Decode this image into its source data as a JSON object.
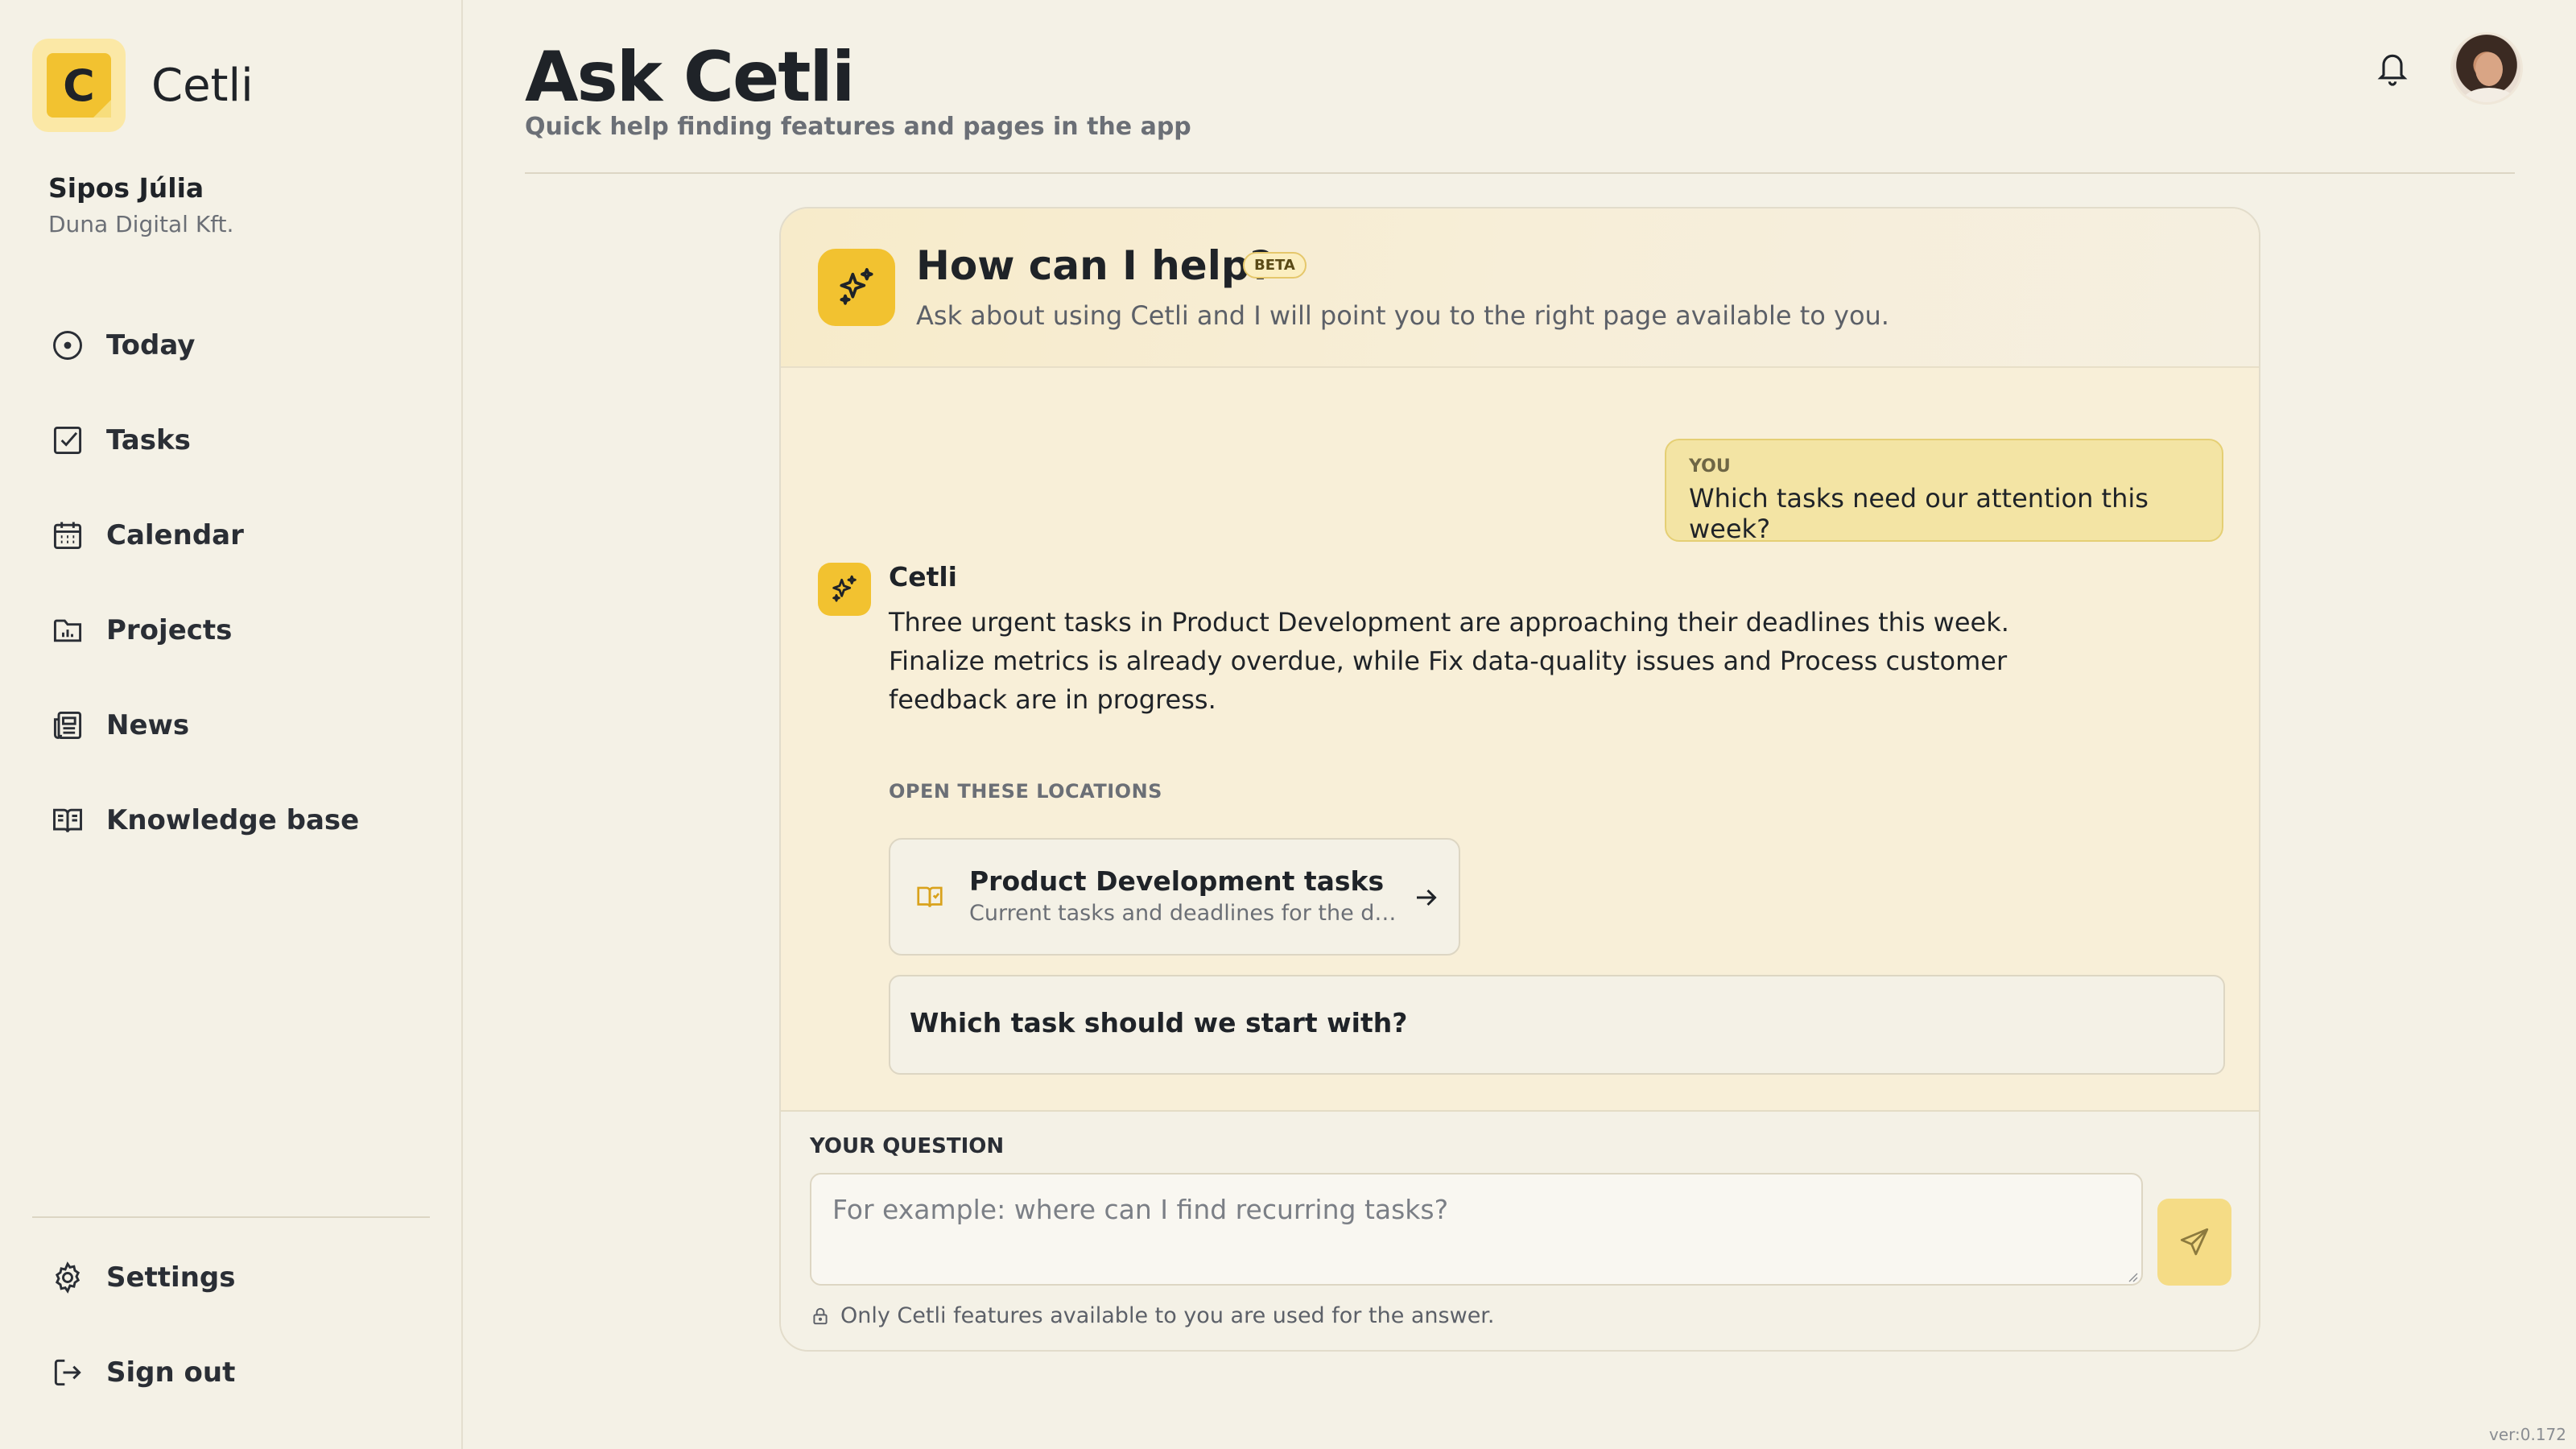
{
  "app": {
    "name": "Cetli",
    "logo_letter": "C"
  },
  "user": {
    "name": "Sipos Júlia",
    "org": "Duna Digital Kft."
  },
  "sidebar": {
    "items": [
      {
        "label": "Today",
        "icon": "clock-circle-icon"
      },
      {
        "label": "Tasks",
        "icon": "checkbox-icon"
      },
      {
        "label": "Calendar",
        "icon": "calendar-icon"
      },
      {
        "label": "Projects",
        "icon": "folder-chart-icon"
      },
      {
        "label": "News",
        "icon": "newspaper-icon"
      },
      {
        "label": "Knowledge base",
        "icon": "book-open-icon"
      }
    ],
    "bottom_items": [
      {
        "label": "Settings",
        "icon": "gear-icon"
      },
      {
        "label": "Sign out",
        "icon": "sign-out-icon"
      }
    ]
  },
  "header": {
    "title": "Ask Cetli",
    "subtitle": "Quick help finding features and pages in the app"
  },
  "assistant_card": {
    "title": "How can I help?",
    "badge": "BETA",
    "subtitle": "Ask about using Cetli and I will point you to the right page available to you."
  },
  "conversation": {
    "user_label": "YOU",
    "user_message": "Which tasks need our attention this week?",
    "assistant_name": "Cetli",
    "assistant_message": "Three urgent tasks in Product Development are approaching their deadlines this week. Finalize metrics is already overdue, while Fix data-quality issues and Process customer feedback are in progress.",
    "locations_label": "OPEN THESE LOCATIONS",
    "location": {
      "title": "Product Development tasks",
      "description": "Current tasks and deadlines for the department"
    },
    "suggestion": "Which task should we start with?"
  },
  "composer": {
    "label": "YOUR QUESTION",
    "value": "",
    "placeholder": "For example: where can I find recurring tasks?",
    "note": "Only Cetli features available to you are used for the answer."
  },
  "version": "ver:0.172",
  "colors": {
    "accent": "#f2c230",
    "background": "#f4f1e6",
    "user_bubble": "#f3e4a4",
    "send_button": "#f5dc86"
  }
}
